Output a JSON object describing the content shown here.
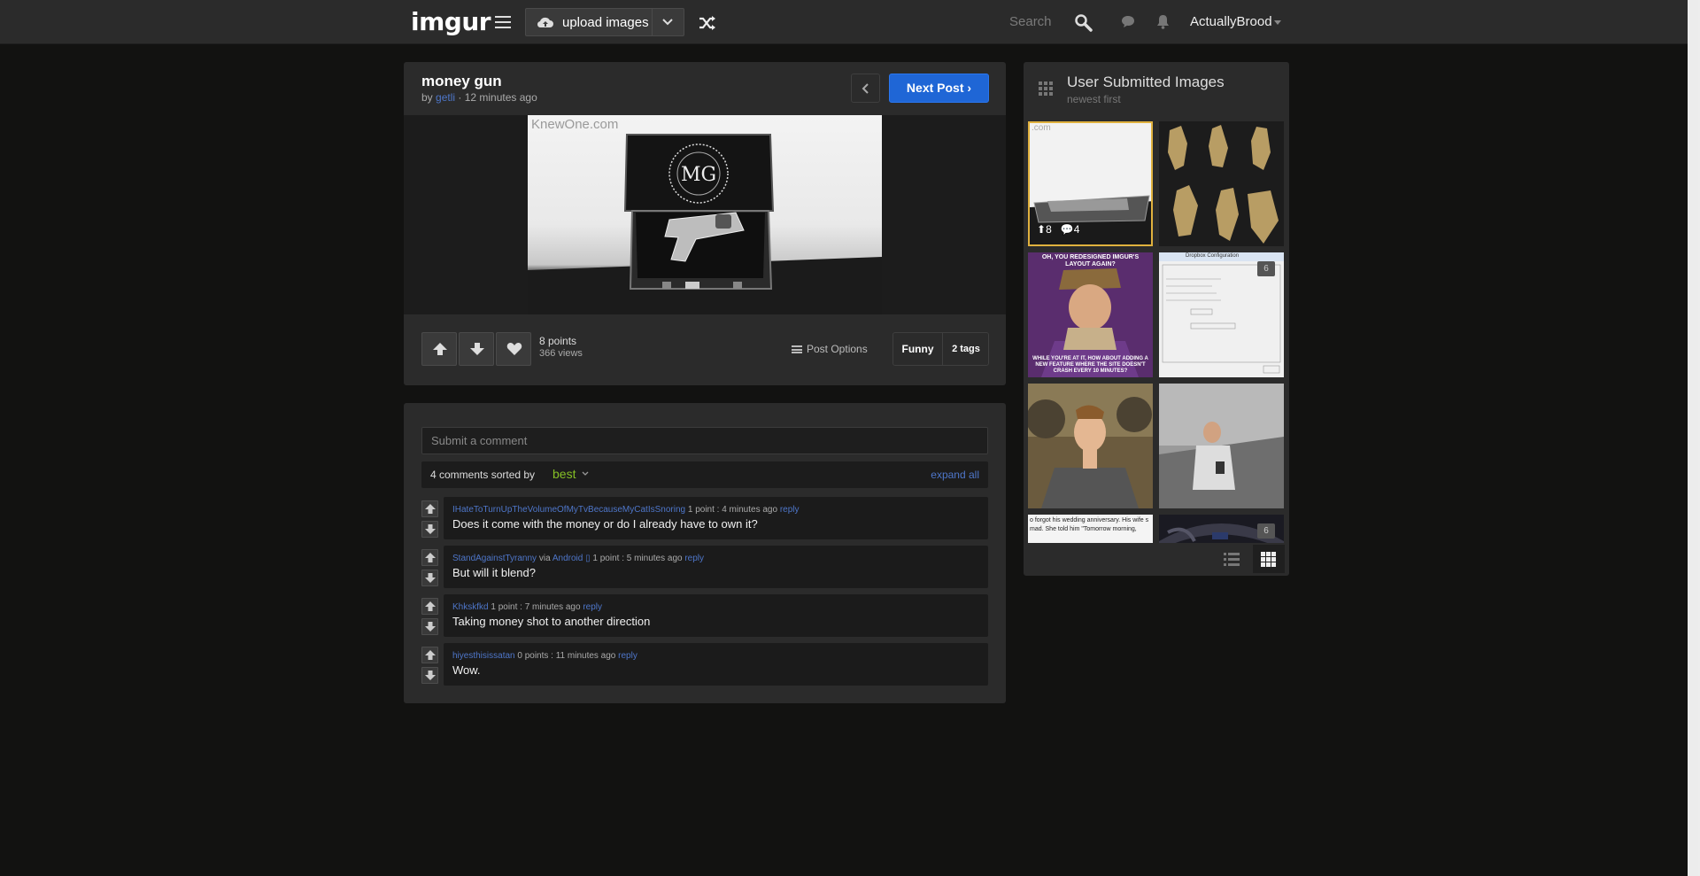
{
  "topbar": {
    "logo": "imgur",
    "upload_label": "upload images",
    "search_placeholder": "Search",
    "username": "ActuallyBrood"
  },
  "post": {
    "title": "money gun",
    "by_prefix": "by ",
    "author": "getli",
    "time": " · 12 minutes ago",
    "next_label": "Next Post",
    "image_watermark": "KnewOne.com",
    "points": "8 points",
    "views": "366 views",
    "post_options": "Post Options",
    "tag": "Funny",
    "tag_count": "2 tags"
  },
  "comments": {
    "placeholder": "Submit a comment",
    "count_text": "4 comments sorted by",
    "sort": "best",
    "expand": "expand all",
    "items": [
      {
        "user": "IHateToTurnUpTheVolumeOfMyTvBecauseMyCatIsSnoring",
        "via": "",
        "device": "",
        "meta": " 1 point : 4 minutes ago ",
        "reply": "reply",
        "text": "Does it come with the money or do I already have to own it?"
      },
      {
        "user": "StandAgainstTyranny",
        "via": " via ",
        "device": "Android ▯",
        "meta": " 1 point : 5 minutes ago ",
        "reply": "reply",
        "text": "But will it blend?"
      },
      {
        "user": "Khkskfkd",
        "via": "",
        "device": "",
        "meta": " 1 point : 7 minutes ago ",
        "reply": "reply",
        "text": "Taking money shot to another direction"
      },
      {
        "user": "hiyesthisissatan",
        "via": "",
        "device": "",
        "meta": " 0 points : 11 minutes ago ",
        "reply": "reply",
        "text": "Wow."
      }
    ]
  },
  "sidebar": {
    "title": "User Submitted Images",
    "subtitle": "newest first",
    "thumbs": [
      {
        "label": "money gun",
        "top_text": ".com",
        "ups": "8",
        "comments": "4",
        "badge": ""
      },
      {
        "label": "figurines",
        "top_text": "",
        "ups": "",
        "comments": "",
        "badge": ""
      },
      {
        "label": "meme",
        "top_text": "OH, YOU REDESIGNED IMGUR'S LAYOUT AGAIN?",
        "bottom_text": "WHILE YOU'RE AT IT, HOW ABOUT ADDING A NEW FEATURE WHERE THE SITE DOESN'T CRASH EVERY 10 MINUTES?",
        "badge": ""
      },
      {
        "label": "dialog",
        "top_text": "Dropbox Configuration",
        "badge": "6"
      },
      {
        "label": "man photo",
        "badge": ""
      },
      {
        "label": "great wall",
        "badge": ""
      },
      {
        "label": "text post",
        "top_text": "o forgot his wedding anniversary. His wife s mad. She told him \"Tomorrow morning,",
        "badge": ""
      },
      {
        "label": "car interior",
        "badge": "6"
      }
    ]
  },
  "colors": {
    "accent_blue": "#1f66d6",
    "link_blue": "#4e76c9",
    "best_green": "#85bf25",
    "selected_gold": "#e0b13e"
  }
}
